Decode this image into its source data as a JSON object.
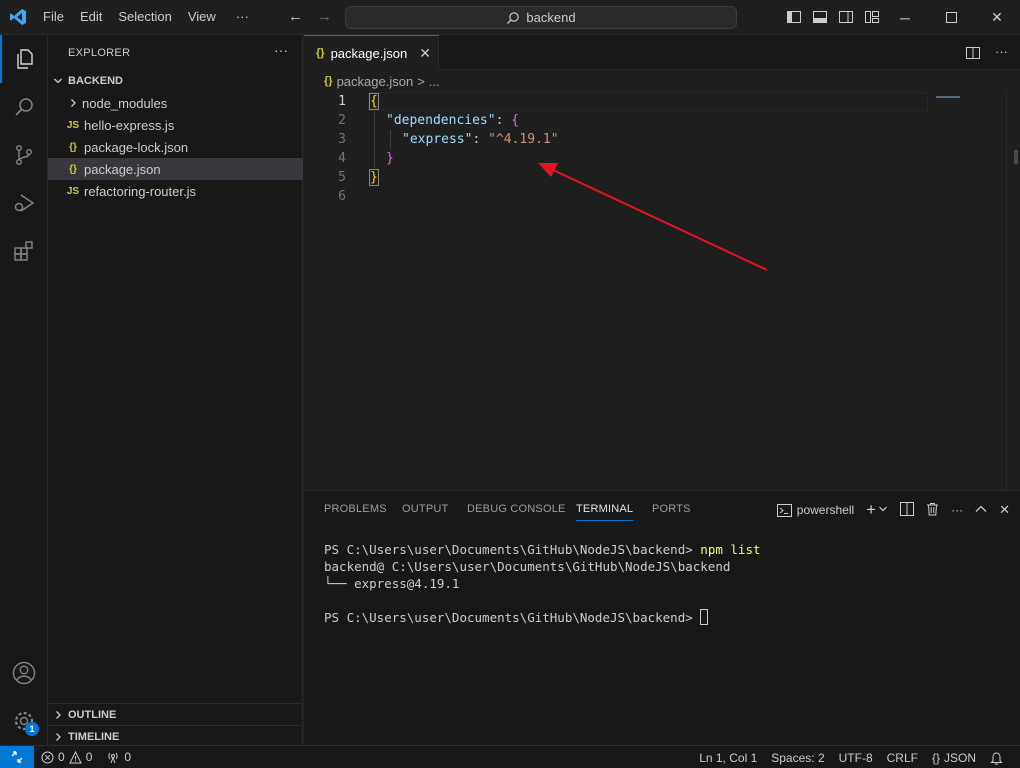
{
  "titlebar": {
    "menu": [
      "File",
      "Edit",
      "Selection",
      "View"
    ],
    "more_label": "···",
    "search_text": "backend"
  },
  "activitybar": {
    "items": [
      "explorer-icon",
      "search-icon",
      "source-control-icon",
      "run-debug-icon",
      "extensions-icon"
    ],
    "bottom": [
      "accounts-icon",
      "manage-gear-icon"
    ],
    "manage_badge": "1"
  },
  "sidebar": {
    "title": "EXPLORER",
    "more_label": "···",
    "folder": "BACKEND",
    "files": [
      {
        "name": "node_modules",
        "type": "folder"
      },
      {
        "name": "hello-express.js",
        "type": "js",
        "icon_text": "JS"
      },
      {
        "name": "package-lock.json",
        "type": "json",
        "icon_text": "{}"
      },
      {
        "name": "package.json",
        "type": "json",
        "icon_text": "{}",
        "selected": true
      },
      {
        "name": "refactoring-router.js",
        "type": "js",
        "icon_text": "JS"
      }
    ],
    "outline": "OUTLINE",
    "timeline": "TIMELINE"
  },
  "editor": {
    "tab": {
      "label": "package.json",
      "icon_text": "{}"
    },
    "breadcrumbs": {
      "icon_text": "{}",
      "file": "package.json",
      "sep": ">",
      "more": "..."
    },
    "line_numbers": [
      "1",
      "2",
      "3",
      "4",
      "5",
      "6"
    ],
    "code": {
      "l1_open": "{",
      "l2_key": "\"dependencies\"",
      "l2_colon": ": ",
      "l2_open": "{",
      "l3_key": "\"express\"",
      "l3_colon": ": ",
      "l3_val": "\"^4.19.1\"",
      "l4_close": "}",
      "l5_close": "}"
    }
  },
  "panel": {
    "tabs": [
      "PROBLEMS",
      "OUTPUT",
      "DEBUG CONSOLE",
      "TERMINAL",
      "PORTS"
    ],
    "active_tab": "TERMINAL",
    "shell": "powershell",
    "terminal": {
      "prompt1": "PS C:\\Users\\user\\Documents\\GitHub\\NodeJS\\backend> ",
      "cmd1": "npm list",
      "out1": "backend@ C:\\Users\\user\\Documents\\GitHub\\NodeJS\\backend",
      "out2": "└── express@4.19.1",
      "prompt2": "PS C:\\Users\\user\\Documents\\GitHub\\NodeJS\\backend> "
    }
  },
  "statusbar": {
    "errors": "0",
    "warnings": "0",
    "ports": "0",
    "position": "Ln 1, Col 1",
    "spaces": "Spaces: 2",
    "encoding": "UTF-8",
    "eol": "CRLF",
    "language_icon": "{}",
    "language": "JSON"
  },
  "colors": {
    "accent": "#0078d4",
    "annotation_arrow": "#e81123"
  }
}
